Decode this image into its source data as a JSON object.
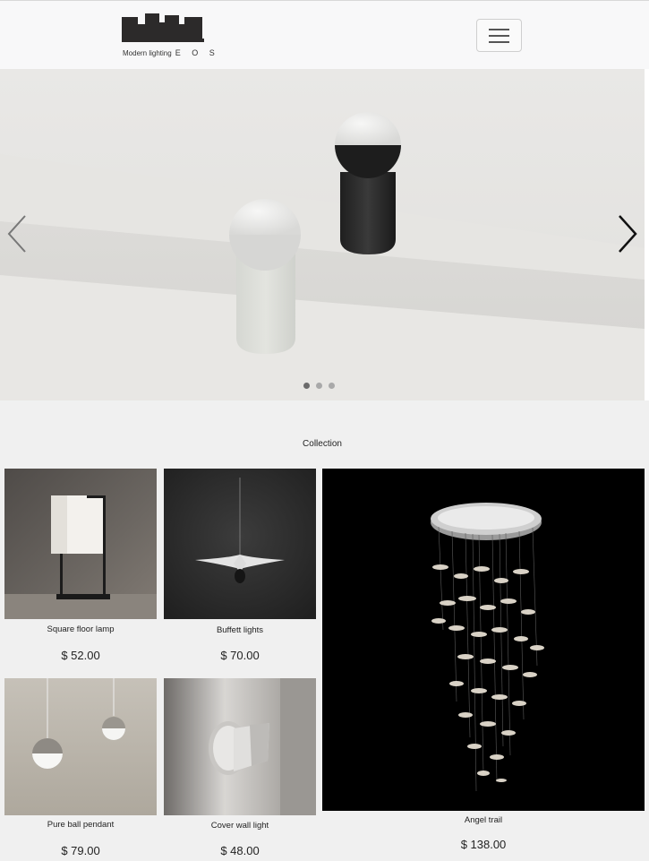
{
  "header": {
    "logo_text": "Modern lighting",
    "logo_brand": "E O S",
    "menu_icon": "hamburger-icon"
  },
  "carousel": {
    "prev_icon": "chevron-left-icon",
    "next_icon": "chevron-right-icon",
    "slide_count": 3,
    "active_slide": 1
  },
  "collection": {
    "title": "Collection",
    "products": [
      {
        "name": "Square floor lamp",
        "price": "$ 52.00"
      },
      {
        "name": "Buffett lights",
        "price": "$ 70.00"
      },
      {
        "name": "Angel trail",
        "price": "$ 138.00"
      },
      {
        "name": "Pure ball pendant",
        "price": "$ 79.00"
      },
      {
        "name": "Cover wall light",
        "price": "$ 48.00"
      }
    ]
  }
}
